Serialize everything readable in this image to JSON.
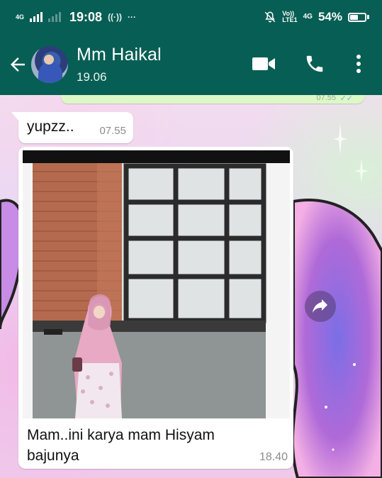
{
  "status_bar": {
    "network_left": "4G",
    "time": "19:08",
    "volte": "Vo))",
    "lte": "LTE1",
    "network_right": "4G",
    "battery": "54%",
    "battery_level": 0.54
  },
  "header": {
    "contact_name": "Mm Haikal",
    "last_seen": "19.06"
  },
  "messages": [
    {
      "text": "yupzz..",
      "time": "07.55",
      "direction": "incoming"
    },
    {
      "type": "image",
      "caption": "Mam..ini karya mam Hisyam bajunya",
      "time": "18.40",
      "direction": "incoming"
    }
  ],
  "previous_message": {
    "time": "07.55"
  },
  "colors": {
    "header": "#075e54",
    "bubble_in": "#ffffff",
    "bubble_out": "#dcf8c6"
  },
  "icons": {
    "back": "arrow-left-icon",
    "video": "video-call-icon",
    "call": "phone-icon",
    "menu": "more-vert-icon",
    "forward": "forward-icon"
  }
}
